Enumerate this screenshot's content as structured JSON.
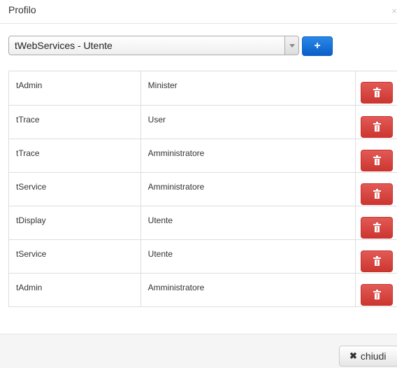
{
  "modal": {
    "title": "Profilo",
    "close_glyph": "×"
  },
  "selector": {
    "value": "tWebServices - Utente"
  },
  "add_button": {
    "icon": "plus-icon",
    "glyph": "+",
    "color": "#0a5fc9"
  },
  "rows": [
    {
      "service": "tAdmin",
      "role": "Minister"
    },
    {
      "service": "tTrace",
      "role": "User"
    },
    {
      "service": "tTrace",
      "role": "Amministratore"
    },
    {
      "service": "tService",
      "role": "Amministratore"
    },
    {
      "service": "tDisplay",
      "role": "Utente"
    },
    {
      "service": "tService",
      "role": "Utente"
    },
    {
      "service": "tAdmin",
      "role": "Amministratore"
    }
  ],
  "delete_button": {
    "icon": "trash-icon",
    "color": "#d9443f"
  },
  "footer": {
    "close_label": "chiudi",
    "close_icon": "x-icon",
    "close_glyph": "✖"
  }
}
